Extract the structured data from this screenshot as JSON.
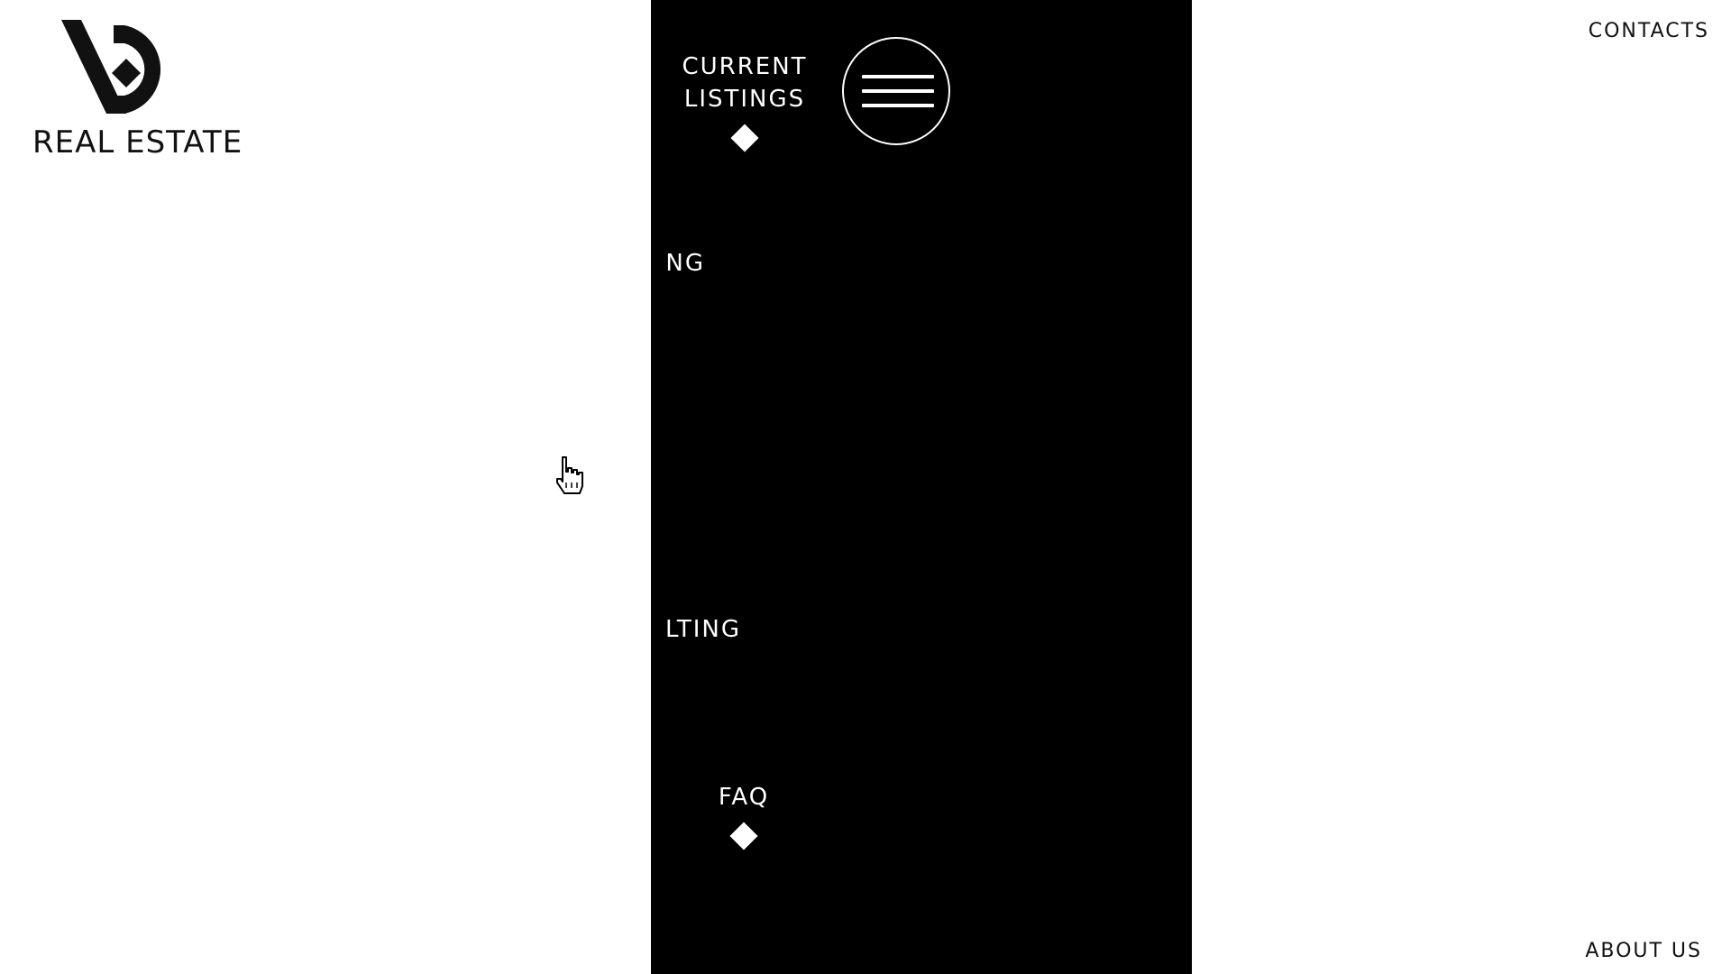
{
  "logo": {
    "text": "REAL ESTATE",
    "icon": "vd-monogram-logo"
  },
  "header": {
    "contacts_label": "CONTACTS"
  },
  "footer": {
    "about_label": "ABOUT US"
  },
  "menu": {
    "toggle_icon": "hamburger-icon",
    "items": [
      {
        "label_line1": "CURRENT",
        "label_line2": "LISTINGS"
      },
      {
        "label": "NG"
      },
      {
        "label": "LTING"
      },
      {
        "label": "FAQ"
      }
    ]
  },
  "colors": {
    "background": "#ffffff",
    "menu_panel": "#000000",
    "text_dark": "#111111",
    "text_light": "#ffffff"
  },
  "cursor": {
    "icon": "hand-pointer-cursor"
  }
}
